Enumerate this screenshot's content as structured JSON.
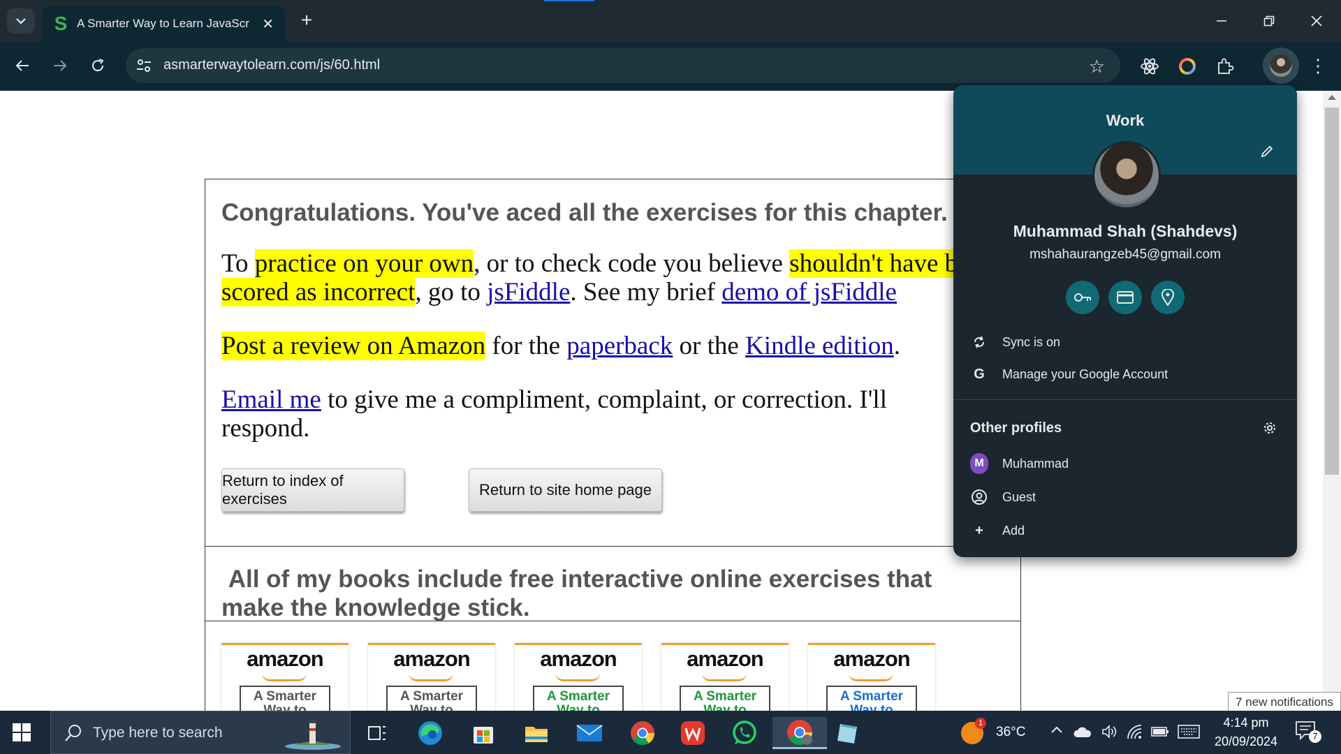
{
  "browser": {
    "tab_title": "A Smarter Way to Learn JavaScr",
    "url": "asmarterwaytolearn.com/js/60.html"
  },
  "page": {
    "congrats": "Congratulations. You've aced all the exercises for this chapter.",
    "practice": {
      "t1": "To ",
      "h1": "practice on your own",
      "t2": ", or to check code you believe ",
      "h2": "shouldn't have been scored as incorrect",
      "t3": ", go to ",
      "link1": "jsFiddle",
      "t4": ". See my brief ",
      "link2": "demo of jsFiddle"
    },
    "review": {
      "h1": "Post a review on Amazon",
      "t1": " for the ",
      "link1": "paperback",
      "t2": " or the ",
      "link2": "Kindle edition",
      "t3": "."
    },
    "email": {
      "link": "Email me",
      "text": " to give me a compliment, complaint, or correction. I'll respond."
    },
    "buttons": {
      "index": "Return to index of exercises",
      "home": "Return to site home page"
    },
    "books_heading": "All of my books include free interactive online exercises that make the knowledge stick.",
    "books": [
      {
        "brand": "amazon",
        "cover": "A Smarter Way to",
        "color": "#555555"
      },
      {
        "brand": "amazon",
        "cover": "A Smarter Way to",
        "color": "#555555"
      },
      {
        "brand": "amazon",
        "cover": "A Smarter Way to",
        "color": "#1a9a3a"
      },
      {
        "brand": "amazon",
        "cover": "A Smarter Way to",
        "color": "#1a9a3a"
      },
      {
        "brand": "amazon",
        "cover": "A Smarter Way to",
        "color": "#1a6fd0"
      }
    ]
  },
  "profile_menu": {
    "title": "Work",
    "name": "Muhammad Shah (Shahdevs)",
    "email": "mshahaurangzeb45@gmail.com",
    "sync": "Sync is on",
    "manage": "Manage your Google Account",
    "other_profiles_heading": "Other profiles",
    "other_profiles": [
      {
        "badge": "M",
        "label": "Muhammad"
      },
      {
        "label": "Guest"
      },
      {
        "label": "Add"
      }
    ]
  },
  "taskbar": {
    "search_placeholder": "Type here to search",
    "weather_temp": "36°C",
    "weather_badge": "1",
    "time": "4:14 pm",
    "date": "20/09/2024",
    "notification_count": "7",
    "notification_toast": "7 new notifications"
  },
  "colors": {
    "highlight": "#ffff00",
    "link": "#1a0dab",
    "profile_band": "#0f4a5a",
    "toolbar": "#0e2833"
  }
}
